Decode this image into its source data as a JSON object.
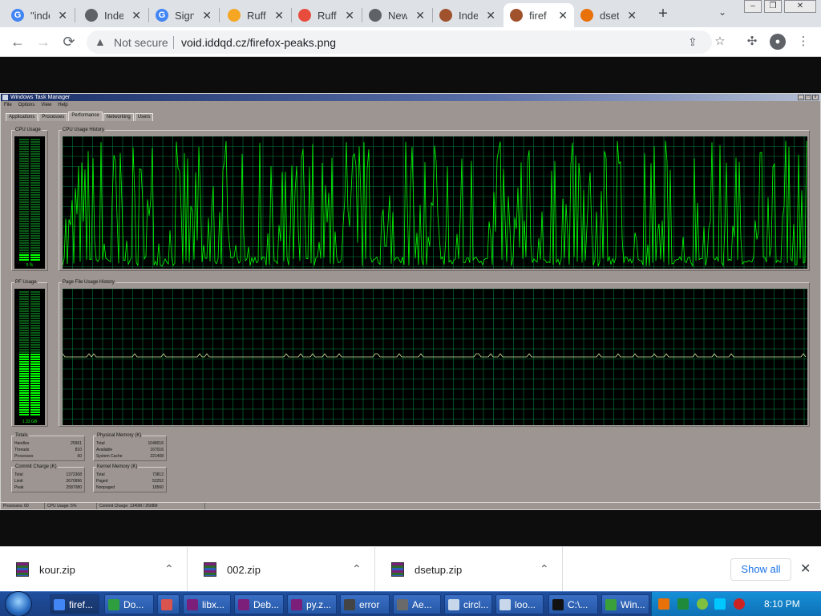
{
  "browser": {
    "tabs": [
      {
        "title": "\"inde",
        "favicon": "G",
        "favicon_color": "#4285f4"
      },
      {
        "title": "Inde",
        "favicon": "globe-icon",
        "favicon_color": "#5f6368"
      },
      {
        "title": "Sign",
        "favicon": "G",
        "favicon_color": "#4285f4"
      },
      {
        "title": "Ruffl",
        "favicon": "ruffle-icon",
        "favicon_color": "#f5a623"
      },
      {
        "title": "Ruffl",
        "favicon": "ruffle-rainbow-icon",
        "favicon_color": "#e74c3c"
      },
      {
        "title": "New",
        "favicon": "chrome-icon",
        "favicon_color": "#5f6368"
      },
      {
        "title": "Inde",
        "favicon": "doom-face-icon",
        "favicon_color": "#a0522d"
      },
      {
        "title": "firef",
        "favicon": "doom-face-icon",
        "favicon_color": "#a0522d",
        "active": true
      },
      {
        "title": "dset",
        "favicon": "gear-icon",
        "favicon_color": "#e8710a"
      }
    ],
    "new_tab": "+",
    "tab_search": "⌄",
    "window_controls": [
      "–",
      "❐",
      "✕"
    ],
    "omnibox": {
      "security_label": "Not secure",
      "url": "void.iddqd.cz/firefox-peaks.png"
    }
  },
  "taskmanager": {
    "title": "Windows Task Manager",
    "menu": [
      "File",
      "Options",
      "View",
      "Help"
    ],
    "tabs": [
      "Applications",
      "Processes",
      "Performance",
      "Networking",
      "Users"
    ],
    "active_tab": "Performance",
    "groups": {
      "cpu_usage": "CPU Usage",
      "cpu_history": "CPU Usage History",
      "pf_usage": "PF Usage",
      "pf_history": "Page File Usage History"
    },
    "cpu_value": "5 %",
    "pf_value": "1.33 GB",
    "cpu_usage_fraction": 0.05,
    "pf_usage_fraction": 0.5,
    "totals": {
      "title": "Totals",
      "rows": [
        {
          "label": "Handles",
          "value": "25961"
        },
        {
          "label": "Threads",
          "value": "810"
        },
        {
          "label": "Processes",
          "value": "60"
        }
      ]
    },
    "physical": {
      "title": "Physical Memory (K)",
      "rows": [
        {
          "label": "Total",
          "value": "1048016"
        },
        {
          "label": "Available",
          "value": "167016"
        },
        {
          "label": "System Cache",
          "value": "221408"
        }
      ]
    },
    "commit": {
      "title": "Commit Charge (K)",
      "rows": [
        {
          "label": "Total",
          "value": "1372368"
        },
        {
          "label": "Limit",
          "value": "2670996"
        },
        {
          "label": "Peak",
          "value": "2587080"
        }
      ]
    },
    "kernel": {
      "title": "Kernel Memory (K)",
      "rows": [
        {
          "label": "Total",
          "value": "73812"
        },
        {
          "label": "Paged",
          "value": "52252"
        },
        {
          "label": "Nonpaged",
          "value": "18560"
        }
      ]
    },
    "status": [
      "Processes: 60",
      "CPU Usage: 5%",
      "Commit Charge: 1340M / 2608M"
    ]
  },
  "downloads": {
    "items": [
      {
        "name": "kour.zip"
      },
      {
        "name": "002.zip"
      },
      {
        "name": "dsetup.zip"
      }
    ],
    "show_all": "Show all",
    "close": "✕"
  },
  "taskbar": {
    "items": [
      {
        "label": "firef...",
        "icon_color": "#4285f4",
        "active": true
      },
      {
        "label": "Do...",
        "icon_color": "#2e9e3e"
      },
      {
        "label": "",
        "icon_color": "#d9534f"
      },
      {
        "label": "libx...",
        "icon_color": "#7b1f7a"
      },
      {
        "label": "Deb...",
        "icon_color": "#7b1f7a"
      },
      {
        "label": "py.z...",
        "icon_color": "#7b1f7a"
      },
      {
        "label": "error",
        "icon_color": "#444444"
      },
      {
        "label": "Ae...",
        "icon_color": "#6a6a6a"
      },
      {
        "label": "circl...",
        "icon_color": "#c8d8ea"
      },
      {
        "label": "loo...",
        "icon_color": "#c8d8ea"
      },
      {
        "label": "C:\\...",
        "icon_color": "#111111"
      },
      {
        "label": "Win...",
        "icon_color": "#3aa03a"
      }
    ],
    "clock": "8:10 PM"
  },
  "colors": {
    "graph_green": "#00ff00",
    "graph_grid": "#008040",
    "chrome_blue": "#1a73e8"
  }
}
